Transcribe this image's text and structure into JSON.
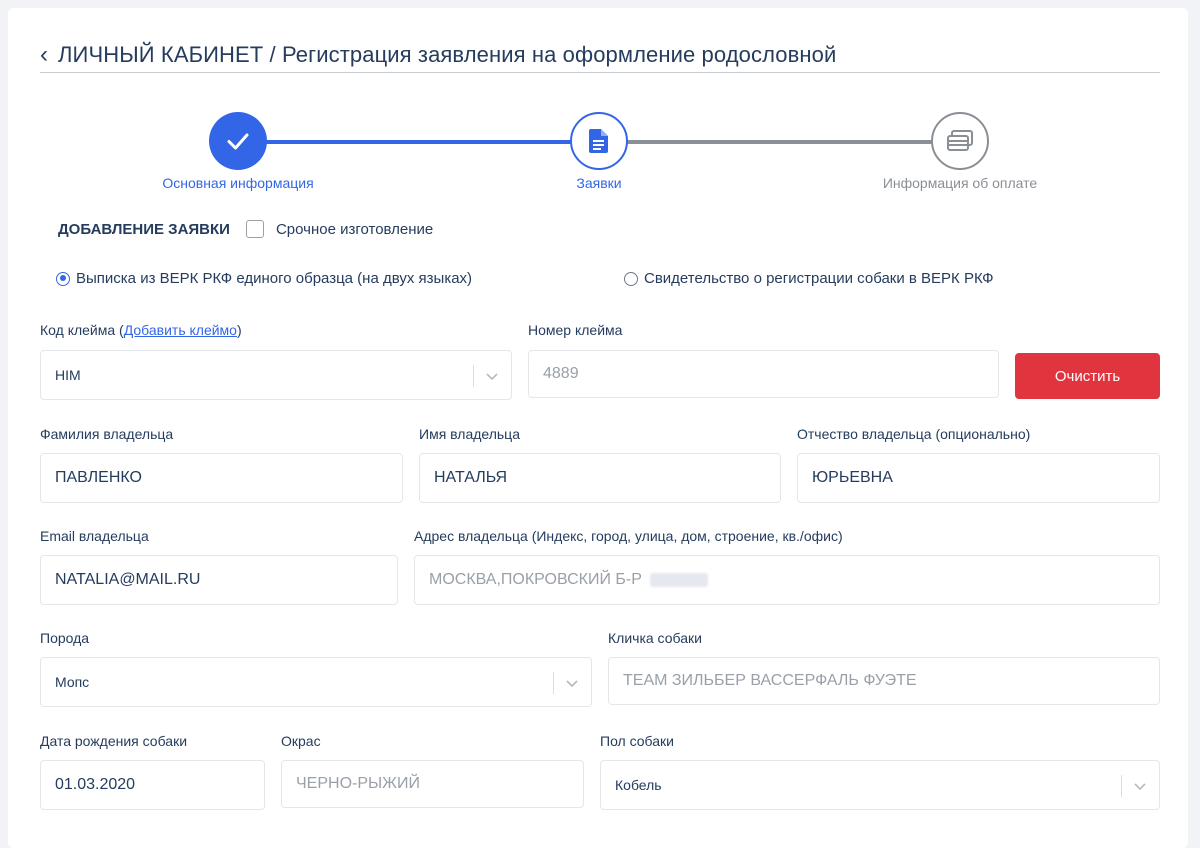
{
  "header": {
    "back_icon": "chevron-left-icon",
    "root": "Личный кабинет",
    "separator": " / ",
    "page": "Регистрация заявления на оформление родословной"
  },
  "stepper": {
    "steps": [
      {
        "label": "Основная информация",
        "state": "done",
        "icon": "check-icon"
      },
      {
        "label": "Заявки",
        "state": "active",
        "icon": "document-icon"
      },
      {
        "label": "Информация об оплате",
        "state": "pending",
        "icon": "cards-icon"
      }
    ]
  },
  "section": {
    "title": "ДОБАВЛЕНИЕ ЗАЯВКИ",
    "urgent_label": "Срочное изготовление",
    "urgent_checked": false
  },
  "doc_type": {
    "options": [
      {
        "label": "Выписка из ВЕРК РКФ единого образца (на двух языках)",
        "selected": true
      },
      {
        "label": "Свидетельство о регистрации собаки в ВЕРК РКФ",
        "selected": false
      }
    ]
  },
  "form": {
    "brand_code_label": "Код клейма",
    "brand_code_link_open": " (",
    "brand_code_link": "Добавить клеймо",
    "brand_code_link_close": ")",
    "brand_code_value": "HIM",
    "brand_number_label": "Номер клейма",
    "brand_number_value": "4889",
    "clear_button": "Очистить",
    "owner_last_label": "Фамилия владельца",
    "owner_last_value": "ПАВЛЕНКО",
    "owner_first_label": "Имя владельца",
    "owner_first_value": "НАТАЛЬЯ",
    "owner_middle_label": "Отчество владельца (опционально)",
    "owner_middle_value": "ЮРЬЕВНА",
    "email_label": "Email владельца",
    "email_value": "NATALIA@MAIL.RU",
    "address_label": "Адрес владельца (Индекс, город, улица, дом, строение, кв./офис)",
    "address_value": "МОСКВА,ПОКРОВСКИЙ Б-Р",
    "breed_label": "Порода",
    "breed_value": "Мопс",
    "dog_name_label": "Кличка собаки",
    "dog_name_value": "TEAM ЗИЛЬБЕР ВАССЕРФАЛЬ ФУЭТЕ",
    "birth_label": "Дата рождения собаки",
    "birth_value": "01.03.2020",
    "color_label": "Окрас",
    "color_value": "ЧЕРНО-РЫЖИЙ",
    "sex_label": "Пол собаки",
    "sex_value": "Кобель"
  },
  "colors": {
    "primary": "#3366e6",
    "danger": "#e0343f",
    "text": "#253c5e",
    "muted": "#9aa0a8"
  }
}
